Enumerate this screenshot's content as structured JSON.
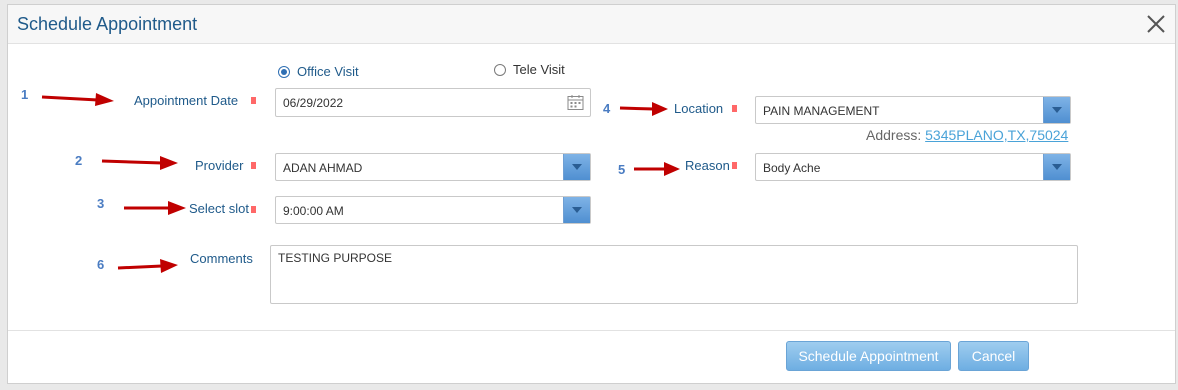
{
  "dialog": {
    "title": "Schedule Appointment"
  },
  "steps": [
    "1",
    "2",
    "3",
    "4",
    "5",
    "6"
  ],
  "visit_type": {
    "office_label": "Office Visit",
    "tele_label": "Tele Visit",
    "selected": "Office Visit"
  },
  "appointment_date": {
    "label": "Appointment Date",
    "value": "06/29/2022"
  },
  "location": {
    "label": "Location",
    "value": "PAIN MANAGEMENT",
    "address_label": "Address:",
    "address_value": "5345PLANO,TX,75024"
  },
  "provider": {
    "label": "Provider",
    "value": "ADAN AHMAD"
  },
  "reason": {
    "label": "Reason",
    "value": "Body Ache"
  },
  "slot": {
    "label": "Select slot",
    "value": "9:00:00 AM"
  },
  "comments": {
    "label": "Comments",
    "value": "TESTING PURPOSE"
  },
  "buttons": {
    "schedule": "Schedule Appointment",
    "cancel": "Cancel"
  },
  "colors": {
    "accent": "#1f5a8a",
    "required_marker": "#ff4d4d",
    "annotation_arrow": "#c00000",
    "button": "#6eaee2",
    "link": "#4aa3d8"
  },
  "icons": [
    "close-icon",
    "calendar-icon",
    "chevron-down-icon",
    "arrow-icon"
  ]
}
